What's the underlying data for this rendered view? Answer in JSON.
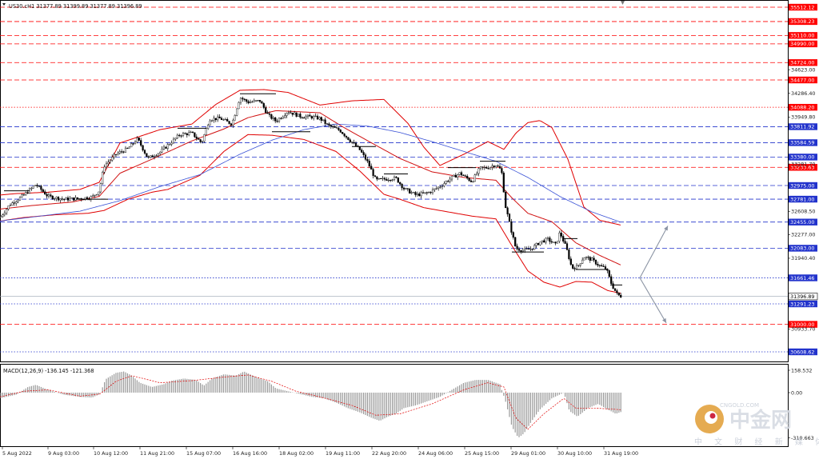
{
  "symbol_header": "US30.cH1  31377.89 31399.89 31377.89 31396.89",
  "macd_header": "MACD(12,26,9) -136.145 -121.368",
  "watermark": {
    "brand": "中金网",
    "site": "CNGOLD.COM",
    "slogan": "中 文 财 经 新 媒 体"
  },
  "chart_data": {
    "type": "candlestick",
    "instrument": "US30.c",
    "timeframe": "H1",
    "ylim": [
      30470,
      35560
    ],
    "x_tick_labels": [
      "5 Aug 2022",
      "9 Aug 03:00",
      "10 Aug 12:00",
      "11 Aug 21:00",
      "15 Aug 07:00",
      "16 Aug 16:00",
      "18 Aug 02:00",
      "19 Aug 11:00",
      "22 Aug 20:00",
      "24 Aug 06:00",
      "25 Aug 15:00",
      "29 Aug 01:00",
      "30 Aug 10:00",
      "31 Aug 19:00"
    ],
    "y_tick_labels": [
      34623.0,
      34286.4,
      33949.8,
      33281.7,
      32608.5,
      32277.0,
      31940.4,
      30933.7
    ],
    "price_levels": [
      {
        "value": 35512.12,
        "label": "35512.12",
        "color": "#ff0000",
        "style": "dashed"
      },
      {
        "value": 35308.23,
        "label": "35308.23",
        "color": "#ff0000",
        "style": "dashed"
      },
      {
        "value": 35110.0,
        "label": "35110.00",
        "color": "#ff0000",
        "style": "dashed"
      },
      {
        "value": 34990.0,
        "label": "34990.00",
        "color": "#ff0000",
        "style": "dashed"
      },
      {
        "value": 34724.0,
        "label": "34724.00",
        "color": "#ff0000",
        "style": "dashed"
      },
      {
        "value": 34477.0,
        "label": "34477.00",
        "color": "#ff0000",
        "style": "dashed"
      },
      {
        "value": 34088.2,
        "label": "34088.20",
        "color": "#ff0000",
        "style": "dotted"
      },
      {
        "value": 33811.92,
        "label": "33811.92",
        "color": "#2233cc",
        "style": "dashed"
      },
      {
        "value": 33584.59,
        "label": "33584.59",
        "color": "#2233cc",
        "style": "dashed"
      },
      {
        "value": 33380.0,
        "label": "33380.00",
        "color": "#2233cc",
        "style": "dashed"
      },
      {
        "value": 33233.63,
        "label": "33233.63",
        "color": "#ff0000",
        "style": "dashed"
      },
      {
        "value": 32975.0,
        "label": "32975.00",
        "color": "#2233cc",
        "style": "dashed"
      },
      {
        "value": 32781.0,
        "label": "32781.00",
        "color": "#2233cc",
        "style": "dashed"
      },
      {
        "value": 32455.0,
        "label": "32455.00",
        "color": "#2233cc",
        "style": "dashed"
      },
      {
        "value": 32083.0,
        "label": "32083.00",
        "color": "#2233cc",
        "style": "dashed"
      },
      {
        "value": 31661.46,
        "label": "31661.46",
        "color": "#2233cc",
        "style": "dotted"
      },
      {
        "value": 31291.23,
        "label": "31291.23",
        "color": "#2233cc",
        "style": "dotted"
      },
      {
        "value": 31000.0,
        "label": "31000.00",
        "color": "#ff0000",
        "style": "dashed"
      },
      {
        "value": 30608.62,
        "label": "30608.62",
        "color": "#2233cc",
        "style": "dotted"
      }
    ],
    "current_price": {
      "value": 31396.89,
      "label": "31396.89"
    },
    "close_path": [
      [
        0,
        32520
      ],
      [
        12,
        32700
      ],
      [
        30,
        32840
      ],
      [
        45,
        32990
      ],
      [
        60,
        32820
      ],
      [
        80,
        32780
      ],
      [
        100,
        32790
      ],
      [
        115,
        32810
      ],
      [
        124,
        32900
      ],
      [
        130,
        33250
      ],
      [
        145,
        33420
      ],
      [
        160,
        33500
      ],
      [
        172,
        33640
      ],
      [
        185,
        33360
      ],
      [
        200,
        33450
      ],
      [
        215,
        33600
      ],
      [
        225,
        33700
      ],
      [
        240,
        33720
      ],
      [
        252,
        33580
      ],
      [
        262,
        33920
      ],
      [
        275,
        33930
      ],
      [
        290,
        33850
      ],
      [
        300,
        34230
      ],
      [
        310,
        34160
      ],
      [
        325,
        34180
      ],
      [
        335,
        33980
      ],
      [
        345,
        33890
      ],
      [
        360,
        34030
      ],
      [
        375,
        33960
      ],
      [
        390,
        33950
      ],
      [
        400,
        33930
      ],
      [
        410,
        33830
      ],
      [
        425,
        33760
      ],
      [
        440,
        33590
      ],
      [
        450,
        33480
      ],
      [
        460,
        33300
      ],
      [
        470,
        33050
      ],
      [
        485,
        33070
      ],
      [
        495,
        33080
      ],
      [
        505,
        32930
      ],
      [
        520,
        32840
      ],
      [
        535,
        32870
      ],
      [
        550,
        32960
      ],
      [
        560,
        33050
      ],
      [
        575,
        33150
      ],
      [
        590,
        33030
      ],
      [
        600,
        33220
      ],
      [
        610,
        33230
      ],
      [
        620,
        33270
      ],
      [
        627,
        33190
      ],
      [
        632,
        32680
      ],
      [
        640,
        32300
      ],
      [
        645,
        32080
      ],
      [
        655,
        32050
      ],
      [
        665,
        32080
      ],
      [
        675,
        32170
      ],
      [
        685,
        32210
      ],
      [
        695,
        32130
      ],
      [
        700,
        32310
      ],
      [
        708,
        32090
      ],
      [
        715,
        31800
      ],
      [
        722,
        31820
      ],
      [
        730,
        31960
      ],
      [
        740,
        31920
      ],
      [
        750,
        31830
      ],
      [
        758,
        31790
      ],
      [
        765,
        31560
      ],
      [
        772,
        31420
      ],
      [
        777,
        31397
      ]
    ],
    "bollinger_upper": [
      [
        0,
        32840
      ],
      [
        20,
        32860
      ],
      [
        60,
        32880
      ],
      [
        100,
        32920
      ],
      [
        124,
        33020
      ],
      [
        150,
        33580
      ],
      [
        200,
        33770
      ],
      [
        240,
        33850
      ],
      [
        270,
        34130
      ],
      [
        300,
        34330
      ],
      [
        330,
        34340
      ],
      [
        360,
        34300
      ],
      [
        400,
        34120
      ],
      [
        440,
        34180
      ],
      [
        480,
        34200
      ],
      [
        510,
        33860
      ],
      [
        530,
        33520
      ],
      [
        550,
        33260
      ],
      [
        580,
        33420
      ],
      [
        610,
        33600
      ],
      [
        630,
        33490
      ],
      [
        645,
        33720
      ],
      [
        660,
        33870
      ],
      [
        675,
        33900
      ],
      [
        690,
        33800
      ],
      [
        710,
        33350
      ],
      [
        730,
        32670
      ],
      [
        750,
        32480
      ],
      [
        777,
        32410
      ]
    ],
    "bollinger_lower": [
      [
        0,
        32470
      ],
      [
        30,
        32520
      ],
      [
        70,
        32560
      ],
      [
        110,
        32580
      ],
      [
        130,
        32620
      ],
      [
        160,
        32780
      ],
      [
        190,
        32880
      ],
      [
        210,
        32920
      ],
      [
        250,
        33120
      ],
      [
        280,
        33460
      ],
      [
        310,
        33700
      ],
      [
        340,
        33690
      ],
      [
        380,
        33630
      ],
      [
        420,
        33460
      ],
      [
        450,
        33180
      ],
      [
        480,
        32850
      ],
      [
        500,
        32780
      ],
      [
        530,
        32660
      ],
      [
        560,
        32600
      ],
      [
        590,
        32540
      ],
      [
        620,
        32500
      ],
      [
        640,
        32120
      ],
      [
        660,
        31760
      ],
      [
        680,
        31600
      ],
      [
        700,
        31530
      ],
      [
        720,
        31610
      ],
      [
        740,
        31600
      ],
      [
        760,
        31480
      ],
      [
        777,
        31440
      ]
    ],
    "bollinger_middle": [
      [
        0,
        32640
      ],
      [
        40,
        32690
      ],
      [
        90,
        32740
      ],
      [
        124,
        32820
      ],
      [
        150,
        33150
      ],
      [
        190,
        33350
      ],
      [
        240,
        33610
      ],
      [
        280,
        33780
      ],
      [
        310,
        33940
      ],
      [
        345,
        34040
      ],
      [
        400,
        34010
      ],
      [
        430,
        33800
      ],
      [
        460,
        33610
      ],
      [
        500,
        33360
      ],
      [
        540,
        33170
      ],
      [
        580,
        33090
      ],
      [
        620,
        33050
      ],
      [
        640,
        32800
      ],
      [
        660,
        32580
      ],
      [
        690,
        32460
      ],
      [
        720,
        32160
      ],
      [
        750,
        31980
      ],
      [
        777,
        31840
      ]
    ],
    "moving_average": [
      [
        0,
        32470
      ],
      [
        100,
        32610
      ],
      [
        150,
        32760
      ],
      [
        200,
        32960
      ],
      [
        250,
        33130
      ],
      [
        300,
        33420
      ],
      [
        340,
        33620
      ],
      [
        380,
        33770
      ],
      [
        420,
        33850
      ],
      [
        460,
        33820
      ],
      [
        500,
        33730
      ],
      [
        540,
        33600
      ],
      [
        580,
        33460
      ],
      [
        620,
        33320
      ],
      [
        660,
        33090
      ],
      [
        700,
        32820
      ],
      [
        740,
        32600
      ],
      [
        777,
        32450
      ]
    ],
    "forecast_arrows": [
      {
        "from": [
          31661,
          800
        ],
        "to": [
          32400,
          835
        ]
      },
      {
        "from": [
          31661,
          800
        ],
        "to": [
          31020,
          833
        ]
      }
    ],
    "macd": {
      "ylim": [
        -360,
        170
      ],
      "y_tick_labels": [
        "158.532",
        "0.00",
        "-319.663"
      ],
      "histogram": [
        [
          0,
          -40
        ],
        [
          20,
          -15
        ],
        [
          35,
          40
        ],
        [
          45,
          55
        ],
        [
          60,
          20
        ],
        [
          80,
          -15
        ],
        [
          100,
          -30
        ],
        [
          115,
          -35
        ],
        [
          125,
          -10
        ],
        [
          132,
          95
        ],
        [
          145,
          140
        ],
        [
          155,
          150
        ],
        [
          165,
          120
        ],
        [
          175,
          70
        ],
        [
          190,
          40
        ],
        [
          205,
          60
        ],
        [
          215,
          85
        ],
        [
          230,
          100
        ],
        [
          245,
          90
        ],
        [
          255,
          50
        ],
        [
          265,
          100
        ],
        [
          280,
          130
        ],
        [
          295,
          120
        ],
        [
          305,
          150
        ],
        [
          320,
          110
        ],
        [
          335,
          80
        ],
        [
          345,
          30
        ],
        [
          360,
          10
        ],
        [
          375,
          -10
        ],
        [
          390,
          -30
        ],
        [
          405,
          -40
        ],
        [
          420,
          -70
        ],
        [
          435,
          -110
        ],
        [
          450,
          -140
        ],
        [
          465,
          -180
        ],
        [
          475,
          -200
        ],
        [
          485,
          -170
        ],
        [
          495,
          -150
        ],
        [
          505,
          -110
        ],
        [
          520,
          -90
        ],
        [
          535,
          -60
        ],
        [
          550,
          -30
        ],
        [
          565,
          20
        ],
        [
          580,
          70
        ],
        [
          595,
          90
        ],
        [
          610,
          90
        ],
        [
          625,
          60
        ],
        [
          632,
          -60
        ],
        [
          640,
          -240
        ],
        [
          648,
          -320
        ],
        [
          655,
          -290
        ],
        [
          665,
          -200
        ],
        [
          675,
          -120
        ],
        [
          690,
          -40
        ],
        [
          705,
          0
        ],
        [
          712,
          -130
        ],
        [
          722,
          -170
        ],
        [
          735,
          -110
        ],
        [
          748,
          -80
        ],
        [
          760,
          -120
        ],
        [
          770,
          -150
        ],
        [
          777,
          -136
        ]
      ],
      "signal": [
        [
          0,
          -30
        ],
        [
          30,
          10
        ],
        [
          60,
          20
        ],
        [
          100,
          -25
        ],
        [
          125,
          -10
        ],
        [
          145,
          80
        ],
        [
          165,
          120
        ],
        [
          200,
          70
        ],
        [
          240,
          85
        ],
        [
          280,
          110
        ],
        [
          310,
          125
        ],
        [
          340,
          80
        ],
        [
          370,
          10
        ],
        [
          400,
          -30
        ],
        [
          440,
          -90
        ],
        [
          470,
          -160
        ],
        [
          500,
          -150
        ],
        [
          540,
          -80
        ],
        [
          580,
          20
        ],
        [
          610,
          70
        ],
        [
          630,
          40
        ],
        [
          645,
          -180
        ],
        [
          660,
          -260
        ],
        [
          680,
          -150
        ],
        [
          705,
          -40
        ],
        [
          720,
          -110
        ],
        [
          745,
          -110
        ],
        [
          777,
          -121
        ]
      ]
    }
  }
}
